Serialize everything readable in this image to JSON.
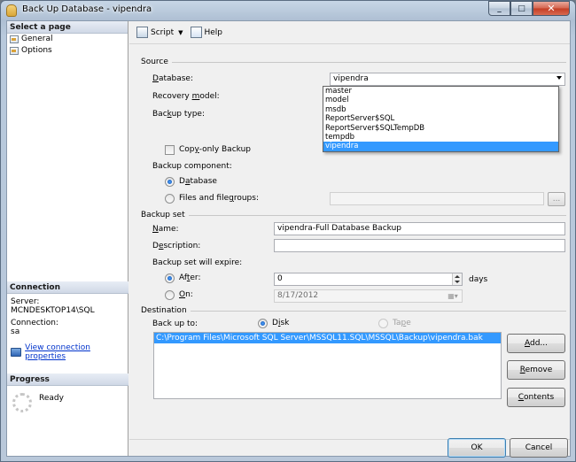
{
  "window": {
    "title": "Back Up Database - vipendra",
    "min_glyph": "_",
    "max_glyph": "□",
    "close_glyph": "✕"
  },
  "left_pane": {
    "select_page_header": "Select a page",
    "pages": [
      {
        "label": "General",
        "icon": "page-icon"
      },
      {
        "label": "Options",
        "icon": "page-icon"
      }
    ],
    "connection_header": "Connection",
    "server_label": "Server:",
    "server_value": "MCNDESKTOP14\\SQL",
    "connection_label": "Connection:",
    "connection_value": "sa",
    "view_connection_link": "View connection properties",
    "progress_header": "Progress",
    "progress_status": "Ready"
  },
  "toolbar": {
    "script_label": "Script",
    "help_label": "Help"
  },
  "source": {
    "group": "Source",
    "database_label": "Database:",
    "database_value": "vipendra",
    "recovery_model_label": "Recovery model:",
    "backup_type_label": "Backup type:",
    "copy_only_label": "Copy-only Backup",
    "backup_component_label": "Backup component:",
    "database_radio_label": "Database",
    "files_radio_label": "Files and filegroups:",
    "browse_label": "..."
  },
  "database_options": [
    "master",
    "model",
    "msdb",
    "ReportServer$SQL",
    "ReportServer$SQLTempDB",
    "tempdb",
    "vipendra"
  ],
  "backup_set": {
    "group": "Backup set",
    "name_label": "Name:",
    "name_value": "vipendra-Full Database Backup",
    "description_label": "Description:",
    "description_value": "",
    "expire_label": "Backup set will expire:",
    "after_label": "After:",
    "after_value": "0",
    "days_label": "days",
    "on_label": "On:",
    "on_value": "8/17/2012"
  },
  "destination": {
    "group": "Destination",
    "back_up_to_label": "Back up to:",
    "disk_label": "Disk",
    "tape_label": "Tape",
    "path": "C:\\Program Files\\Microsoft SQL Server\\MSSQL11.SQL\\MSSQL\\Backup\\vipendra.bak",
    "add_label": "Add...",
    "remove_label": "Remove",
    "contents_label": "Contents"
  },
  "footer": {
    "ok_label": "OK",
    "cancel_label": "Cancel"
  }
}
